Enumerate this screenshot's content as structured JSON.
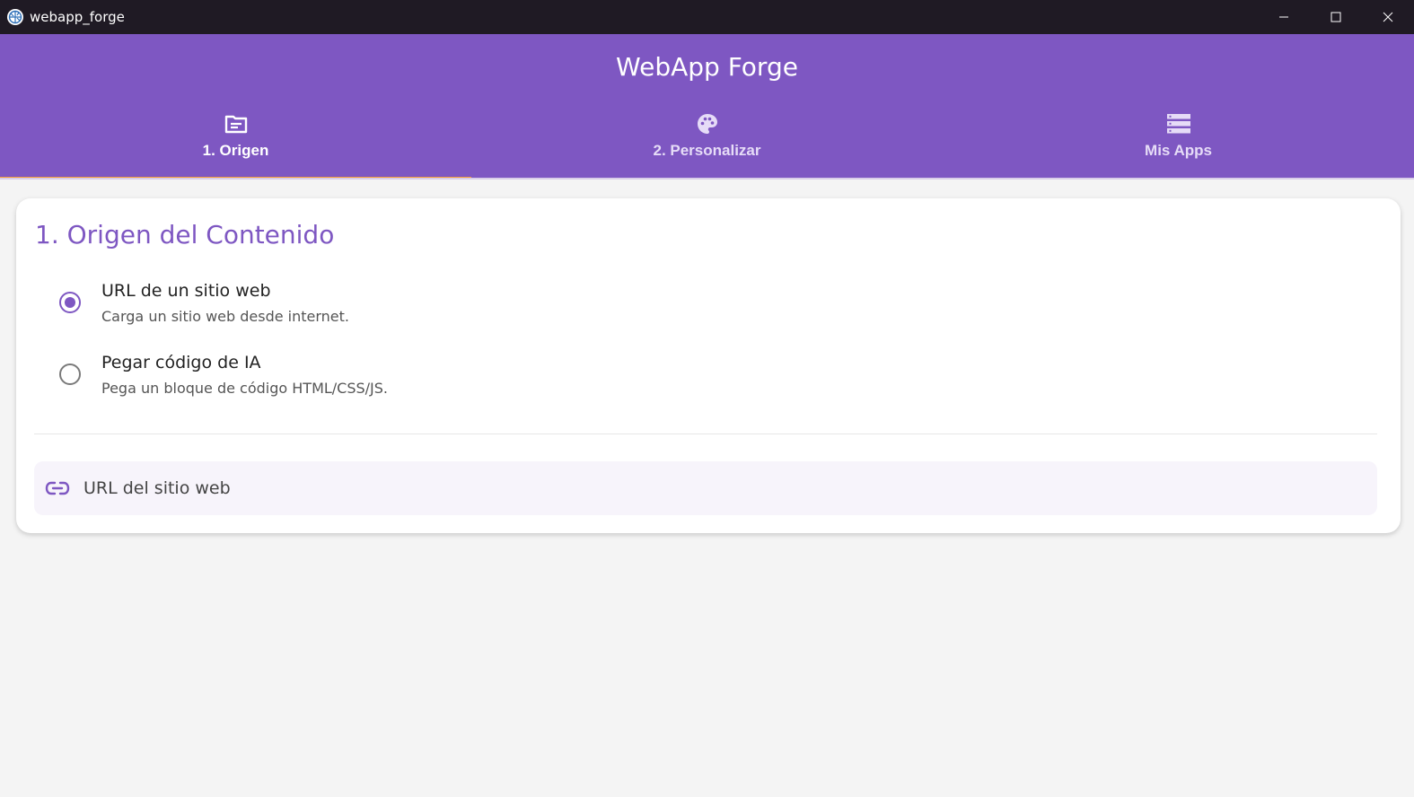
{
  "window": {
    "title": "webapp_forge",
    "icon": "flutter-globe-icon"
  },
  "appbar": {
    "title": "WebApp Forge",
    "accent_color": "#7e57c2",
    "indicator_color": "#f39a38"
  },
  "tabs": [
    {
      "label": "1. Origen",
      "icon": "folder-icon",
      "active": true
    },
    {
      "label": "2. Personalizar",
      "icon": "palette-icon",
      "active": false
    },
    {
      "label": "Mis Apps",
      "icon": "storage-icon",
      "active": false
    }
  ],
  "card": {
    "title": "1. Origen del Contenido",
    "options": [
      {
        "title": "URL de un sitio web",
        "subtitle": "Carga un sitio web desde internet.",
        "selected": true
      },
      {
        "title": "Pegar código de IA",
        "subtitle": "Pega un bloque de código HTML/CSS/JS.",
        "selected": false
      }
    ],
    "url_field": {
      "placeholder": "URL del sitio web",
      "icon": "link-icon",
      "value": ""
    }
  }
}
